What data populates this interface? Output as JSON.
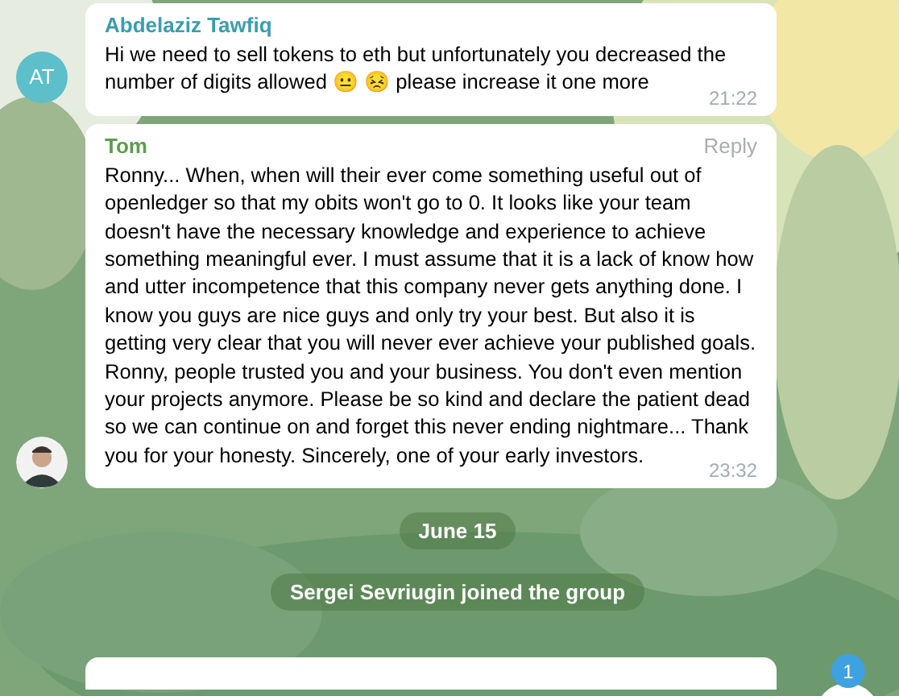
{
  "messages": [
    {
      "kind": "message",
      "sender": "Abdelaziz Tawfiq",
      "color": "#3a9db0",
      "avatar": {
        "kind": "initials",
        "initials": "AT",
        "color": "#5cbfc9"
      },
      "text": "Hi we need to sell tokens to eth but unfortunately you decreased the number of digits allowed 😐 😣 please increase it one more",
      "time": "21:22"
    },
    {
      "kind": "message",
      "sender": "Tom",
      "color": "#5a9e4e",
      "reply": "Reply",
      "text": "Ronny... When, when will their ever come something useful out of openledger so that my obits won't go to 0. It looks like your team doesn't have the necessary knowledge and experience to achieve something meaningful ever. I must assume that it is a lack of know how and utter  incompetence that this company never gets anything done. I know you guys are nice guys and only try your best. But also it is getting very clear that you will never ever achieve your published goals. Ronny, people trusted you and your business. You don't even mention your projects anymore. Please  be so kind and declare the patient dead so we can continue on and forget this never ending nightmare... Thank you for your honesty. Sincerely, one of your early investors.",
      "time": "23:32"
    },
    {
      "kind": "date",
      "text": "June 15"
    },
    {
      "kind": "service",
      "text": "Sergei Sevriugin joined the group"
    }
  ],
  "scroll_down_badge": "1"
}
